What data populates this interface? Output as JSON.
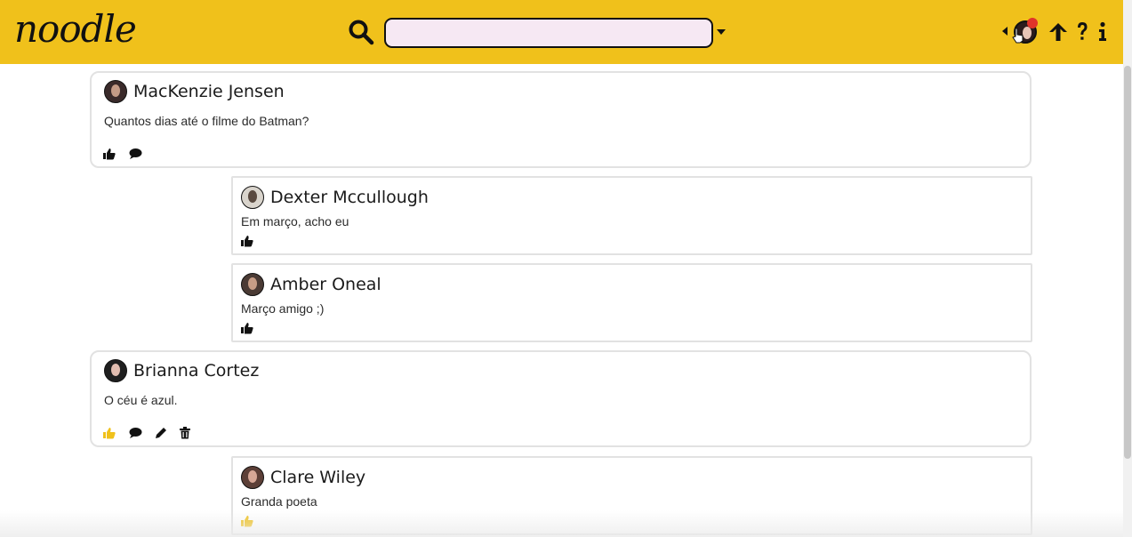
{
  "app": {
    "logo": "noodle"
  },
  "search": {
    "placeholder": "",
    "value": ""
  },
  "colors": {
    "header": "#f0c11b",
    "like_active": "#f0c11b",
    "notification": "#e0332a"
  },
  "icons": [
    "search-icon",
    "chevron-down-icon",
    "chevron-left-icon",
    "arrow-up-icon",
    "help-icon",
    "info-icon",
    "thumbs-up-icon",
    "comment-icon",
    "edit-icon",
    "trash-icon"
  ],
  "feed": {
    "post1": {
      "author": "MacKenzie Jensen",
      "text": "Quantos dias até o filme do Batman?"
    },
    "reply1": {
      "author": "Dexter Mccullough",
      "text": "Em março, acho eu"
    },
    "reply2": {
      "author": "Amber Oneal",
      "text": "Março amigo ;)"
    },
    "post2": {
      "author": "Brianna Cortez",
      "text": "O céu é azul."
    },
    "reply3": {
      "author": "Clare Wiley",
      "text": "Granda poeta"
    }
  }
}
